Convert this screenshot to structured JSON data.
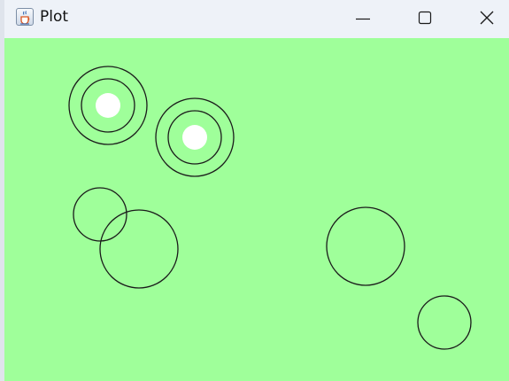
{
  "window": {
    "title": "Plot",
    "app_icon": "java-cup-icon",
    "buttons": {
      "minimize": "minimize-icon",
      "maximize": "maximize-icon",
      "close": "close-icon"
    }
  },
  "canvas": {
    "background": "#9fff9a",
    "stroke_color": "#1a1a1a",
    "fill_color": "#ffffff"
  }
}
